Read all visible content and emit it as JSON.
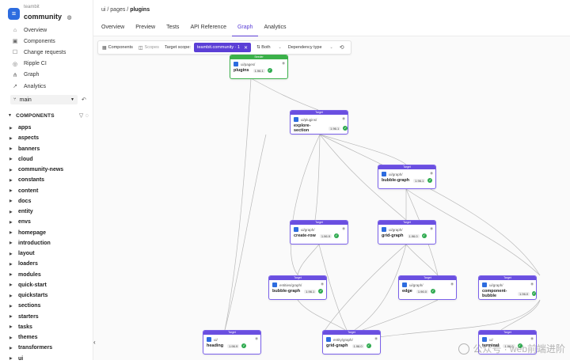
{
  "brand": {
    "org": "teambit",
    "name": "community",
    "globe_icon": "globe-icon"
  },
  "nav": [
    {
      "label": "Overview",
      "icon": "overview-icon"
    },
    {
      "label": "Components",
      "icon": "components-icon"
    },
    {
      "label": "Change requests",
      "icon": "change-requests-icon"
    },
    {
      "label": "Ripple CI",
      "icon": "ripple-icon"
    },
    {
      "label": "Graph",
      "icon": "graph-icon"
    },
    {
      "label": "Analytics",
      "icon": "analytics-icon"
    }
  ],
  "branch": {
    "label": "main"
  },
  "components_header": {
    "label": "COMPONENTS"
  },
  "tree": [
    "apps",
    "aspects",
    "banners",
    "cloud",
    "community-news",
    "constants",
    "content",
    "docs",
    "entity",
    "envs",
    "homepage",
    "introduction",
    "layout",
    "loaders",
    "modules",
    "quick-start",
    "quickstarts",
    "sections",
    "starters",
    "tasks",
    "themes",
    "transformers",
    "ui"
  ],
  "breadcrumb": {
    "path": "ui / pages / ",
    "current": "plugins"
  },
  "tabs": [
    {
      "label": "Overview",
      "active": false
    },
    {
      "label": "Preview",
      "active": false
    },
    {
      "label": "Tests",
      "active": false
    },
    {
      "label": "API Reference",
      "active": false
    },
    {
      "label": "Graph",
      "active": true
    },
    {
      "label": "Analytics",
      "active": false
    }
  ],
  "toolbar": {
    "components": "Components",
    "scopes": "Scopes",
    "target_scope": "Target scope:",
    "scope_chip": "teambit.community · 1",
    "both": "Both",
    "dependency_type": "Dependency type"
  },
  "colors": {
    "accent": "#5b3fd6",
    "target": "#6a4fe0",
    "seeder": "#3bb14a",
    "ok": "#2eaa4f"
  },
  "nodes": [
    {
      "header": "Seeder",
      "path": "ui/pages/",
      "name": "plugins",
      "version": "1.96.1"
    },
    {
      "header": "Target",
      "path": "ui/plugins/",
      "name": "explore-section",
      "version": "1.96.1"
    },
    {
      "header": "Target",
      "path": "ui/graph/",
      "name": "bubble-graph",
      "version": "1.96.1"
    },
    {
      "header": "Target",
      "path": "ui/graph/",
      "name": "create-row",
      "version": "1.96.9"
    },
    {
      "header": "Target",
      "path": "ui/graph/",
      "name": "grid-graph",
      "version": "1.96.0"
    },
    {
      "header": "Target",
      "path": "entities/graph/",
      "name": "bubble-graph",
      "version": "1.96.1"
    },
    {
      "header": "Target",
      "path": "ui/graph/",
      "name": "edge",
      "version": "1.96.0"
    },
    {
      "header": "Target",
      "path": "ui/graph/",
      "name": "component-bubble",
      "version": "1.96.0"
    },
    {
      "header": "Target",
      "path": "ui/",
      "name": "heading",
      "version": "1.96.9"
    },
    {
      "header": "Target",
      "path": "entity/graph/",
      "name": "grid-graph",
      "version": "1.96.0"
    },
    {
      "header": "Target",
      "path": "ui/",
      "name": "terminal",
      "version": "1.96.0"
    }
  ],
  "watermark": "公众号 · web前端进阶"
}
